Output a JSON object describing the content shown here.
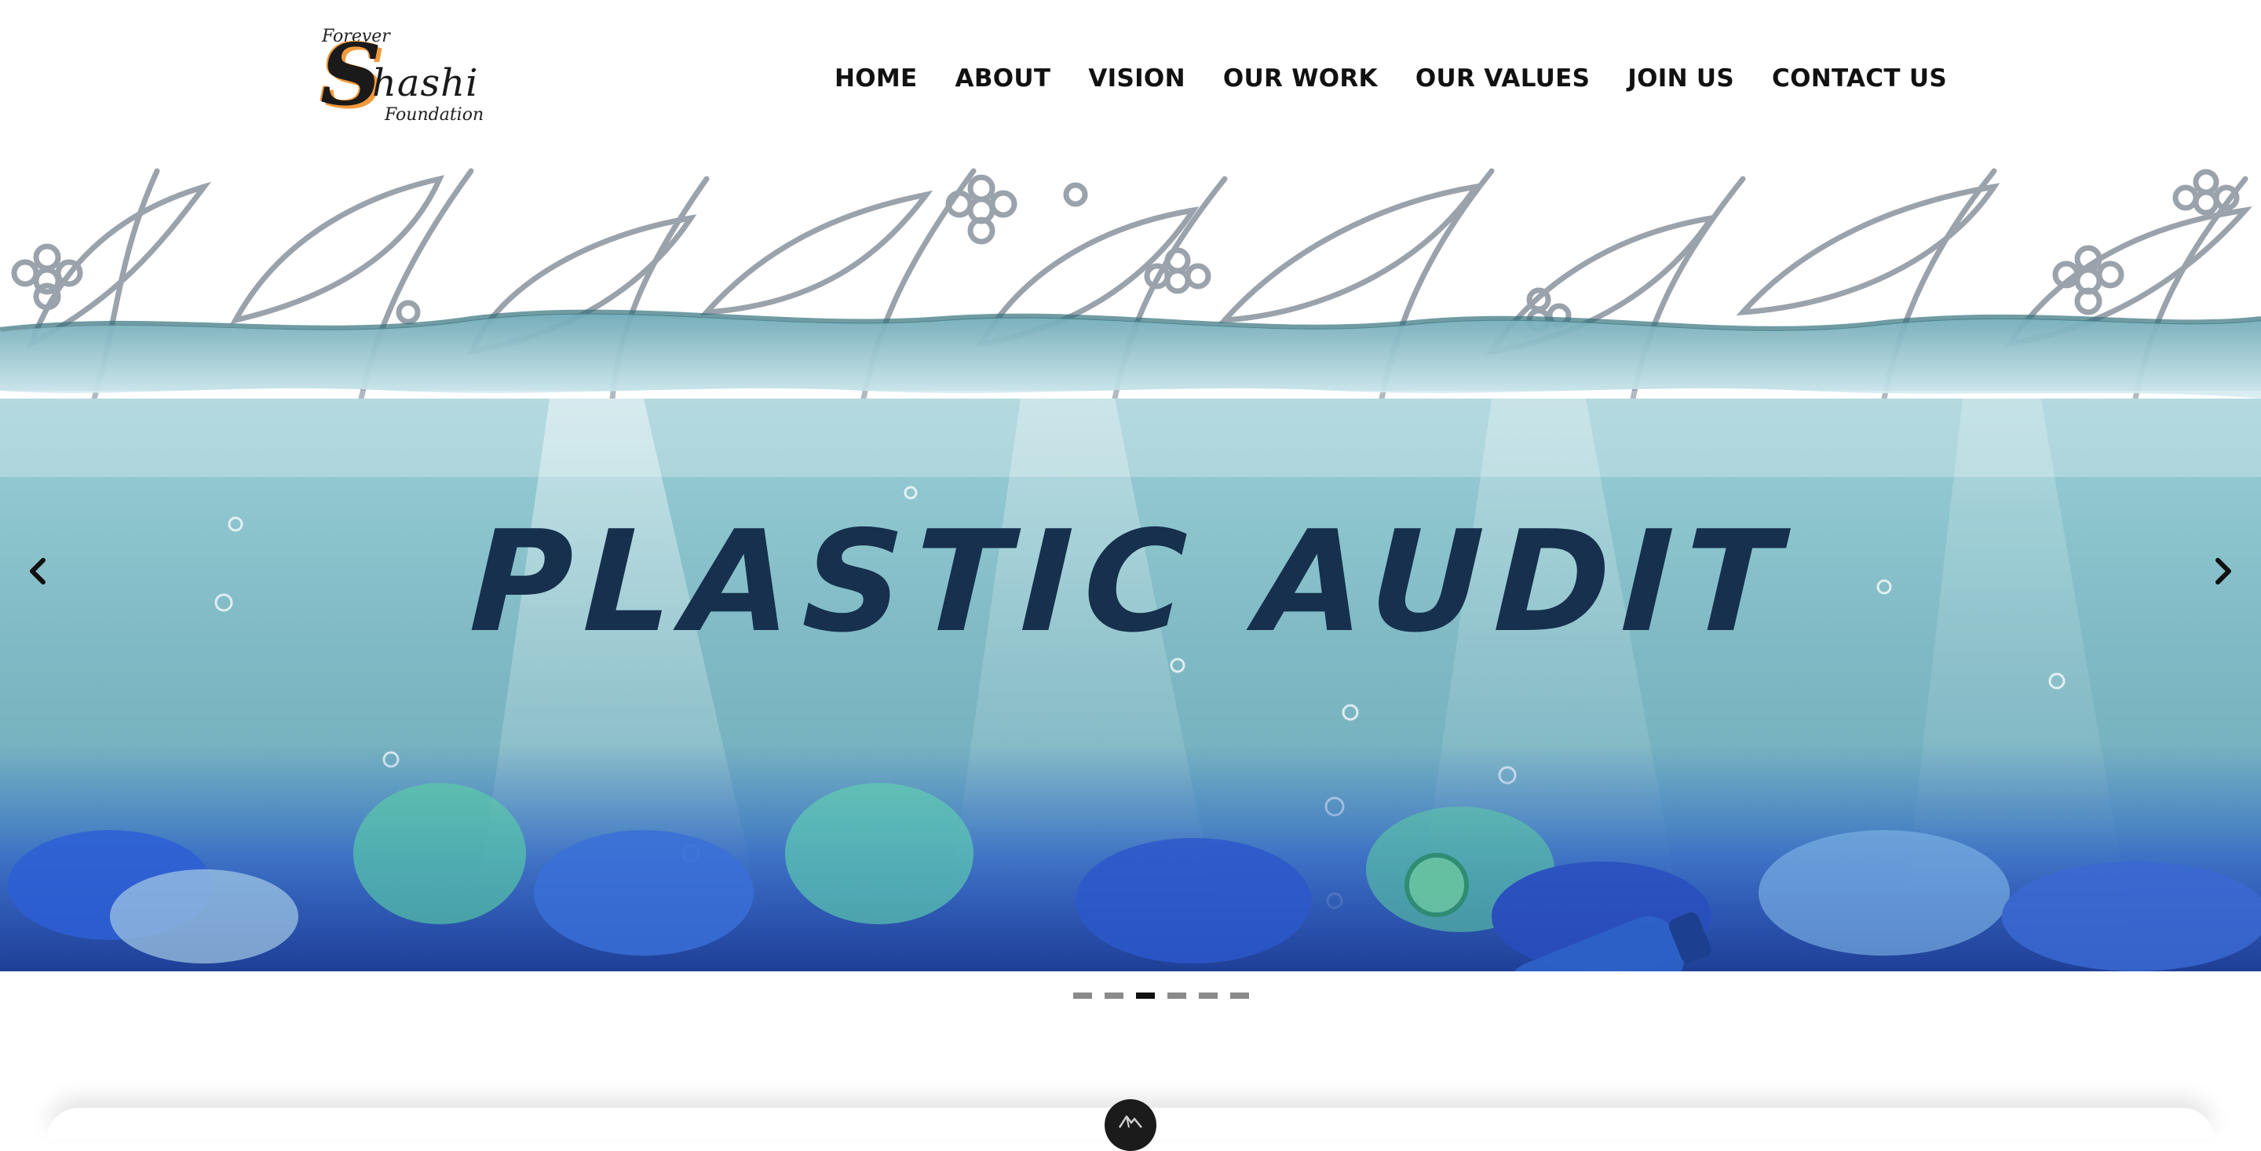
{
  "logo": {
    "line1": "Forever",
    "initial": "S",
    "rest": "hashi",
    "line3": "Foundation"
  },
  "nav": {
    "items": [
      {
        "label": "HOME"
      },
      {
        "label": "ABOUT"
      },
      {
        "label": "VISION"
      },
      {
        "label": "OUR WORK"
      },
      {
        "label": "OUR VALUES"
      },
      {
        "label": "JOIN US"
      },
      {
        "label": "CONTACT US"
      }
    ]
  },
  "hero": {
    "title": "PLASTIC AUDIT",
    "prev_icon": "chevron-left-icon",
    "next_icon": "chevron-right-icon",
    "slide_count": 6,
    "active_slide": 3
  },
  "colors": {
    "title": "#16304d",
    "logo_accent": "#f39a3c",
    "indicator": "#8a8a8a",
    "indicator_active": "#111111"
  },
  "fab": {
    "icon": "mountain-logo-icon"
  }
}
